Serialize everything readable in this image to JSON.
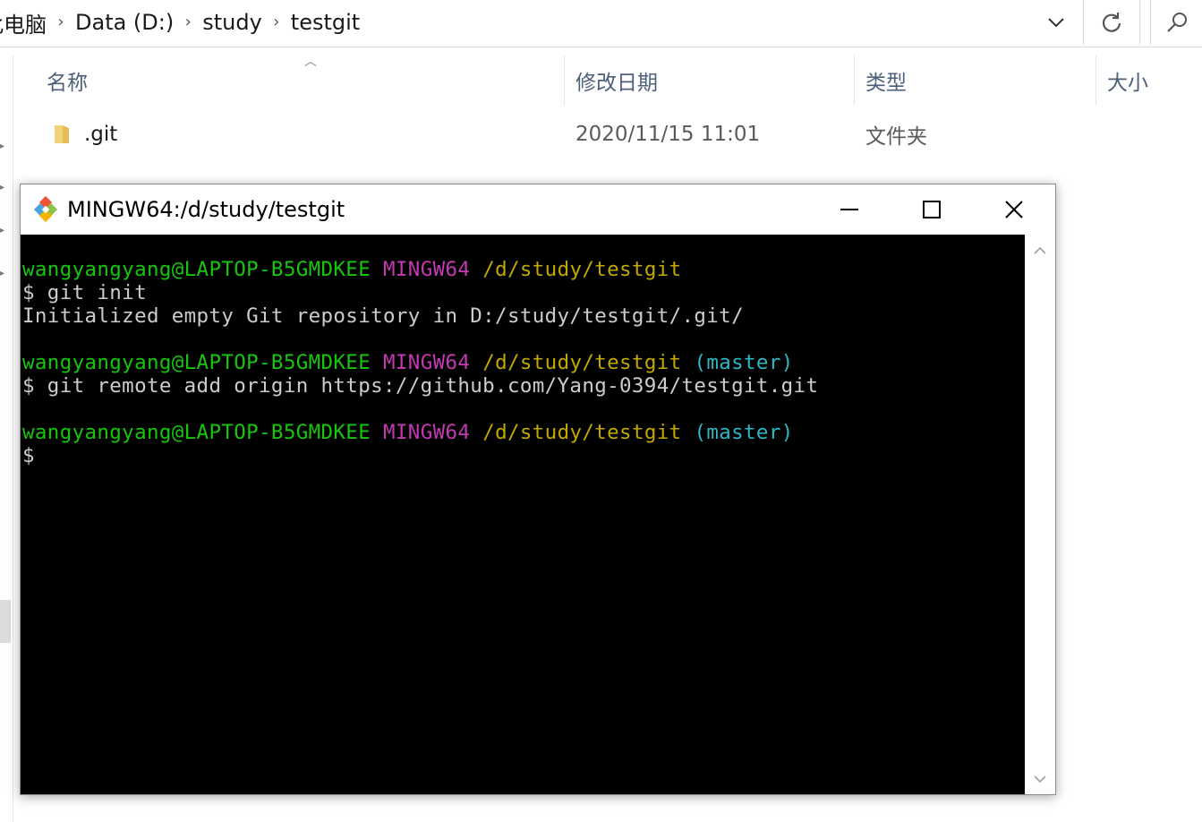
{
  "explorer": {
    "breadcrumb": [
      "此电脑",
      "Data (D:)",
      "study",
      "testgit"
    ],
    "breadcrumb_separator": "›",
    "icons": {
      "history_dropdown": "chevron-down-icon",
      "refresh": "refresh-icon",
      "search": "search-icon"
    },
    "columns": {
      "name": "名称",
      "modified": "修改日期",
      "type": "类型",
      "size": "大小"
    },
    "files": [
      {
        "name": ".git",
        "modified": "2020/11/15 11:01",
        "type": "文件夹",
        "size": "",
        "icon": "folder-icon"
      }
    ],
    "folder_color": "#e8c16b"
  },
  "terminal": {
    "title": "MINGW64:/d/study/testgit",
    "app_icon": "git-bash-icon",
    "lines": [
      {
        "user": "wangyangyang@LAPTOP-B5GMDKEE",
        "system": "MINGW64",
        "path": "/d/study/testgit",
        "branch": ""
      },
      {
        "text": "$ git init"
      },
      {
        "text": "Initialized empty Git repository in D:/study/testgit/.git/"
      },
      {
        "text": ""
      },
      {
        "user": "wangyangyang@LAPTOP-B5GMDKEE",
        "system": "MINGW64",
        "path": "/d/study/testgit",
        "branch": "(master)"
      },
      {
        "text": "$ git remote add origin https://github.com/Yang-0394/testgit.git"
      },
      {
        "text": ""
      },
      {
        "user": "wangyangyang@LAPTOP-B5GMDKEE",
        "system": "MINGW64",
        "path": "/d/study/testgit",
        "branch": "(master)"
      },
      {
        "text": "$"
      }
    ],
    "colors": {
      "background": "#000000",
      "user": "#16c60c",
      "system": "#c239b3",
      "path": "#c1a800",
      "branch": "#2fb6c4",
      "text": "#cccccc"
    }
  }
}
